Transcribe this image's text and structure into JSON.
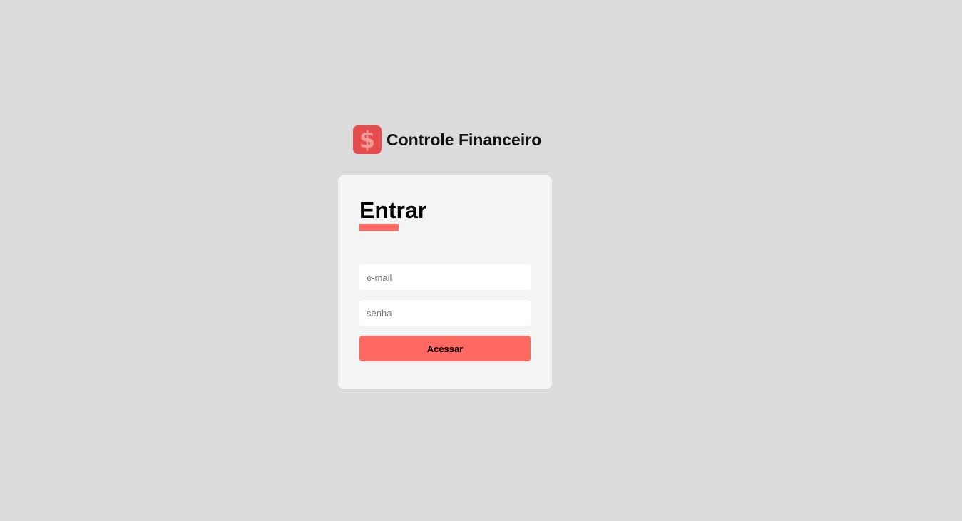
{
  "brand": {
    "icon": "dollar-sign-icon",
    "icon_glyph": "$",
    "title": "Controle Financeiro"
  },
  "login": {
    "title": "Entrar",
    "email": {
      "placeholder": "e-mail",
      "value": ""
    },
    "password": {
      "placeholder": "senha",
      "value": ""
    },
    "submit_label": "Acessar"
  },
  "colors": {
    "background": "#dcdcdc",
    "card": "#f4f4f4",
    "accent": "#ff6961",
    "brand_icon": "#e44c4e"
  }
}
